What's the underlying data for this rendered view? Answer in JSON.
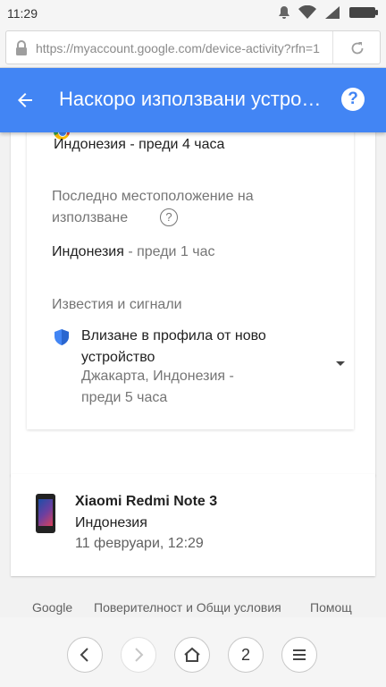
{
  "status_bar": {
    "time": "11:29"
  },
  "browser": {
    "url": "https://myaccount.google.com/device-activity?rfn=1"
  },
  "app_bar": {
    "title": "Наскоро използвани устройства"
  },
  "activity": {
    "first_location": "Индонезия - преди 4 часа",
    "last_location_heading": "Последно местоположение на използване",
    "last_location_country": "Индонезия",
    "last_location_time": " - преди 1 час",
    "alerts_heading": "Известия и сигнали",
    "alert_title": "Влизане в профила от ново устройство",
    "alert_detail": "Джакарта, Индонезия - преди 5 часа"
  },
  "device": {
    "name": "Xiaomi Redmi Note 3",
    "country": "Индонезия",
    "time": "11 февруари, 12:29"
  },
  "footer": {
    "links": [
      "Google",
      "Поверителност и Общи условия",
      "Помощ"
    ]
  },
  "nav": {
    "tab_count": "2"
  },
  "colors": {
    "accent": "#4285f4",
    "shield": "#4285f4"
  }
}
